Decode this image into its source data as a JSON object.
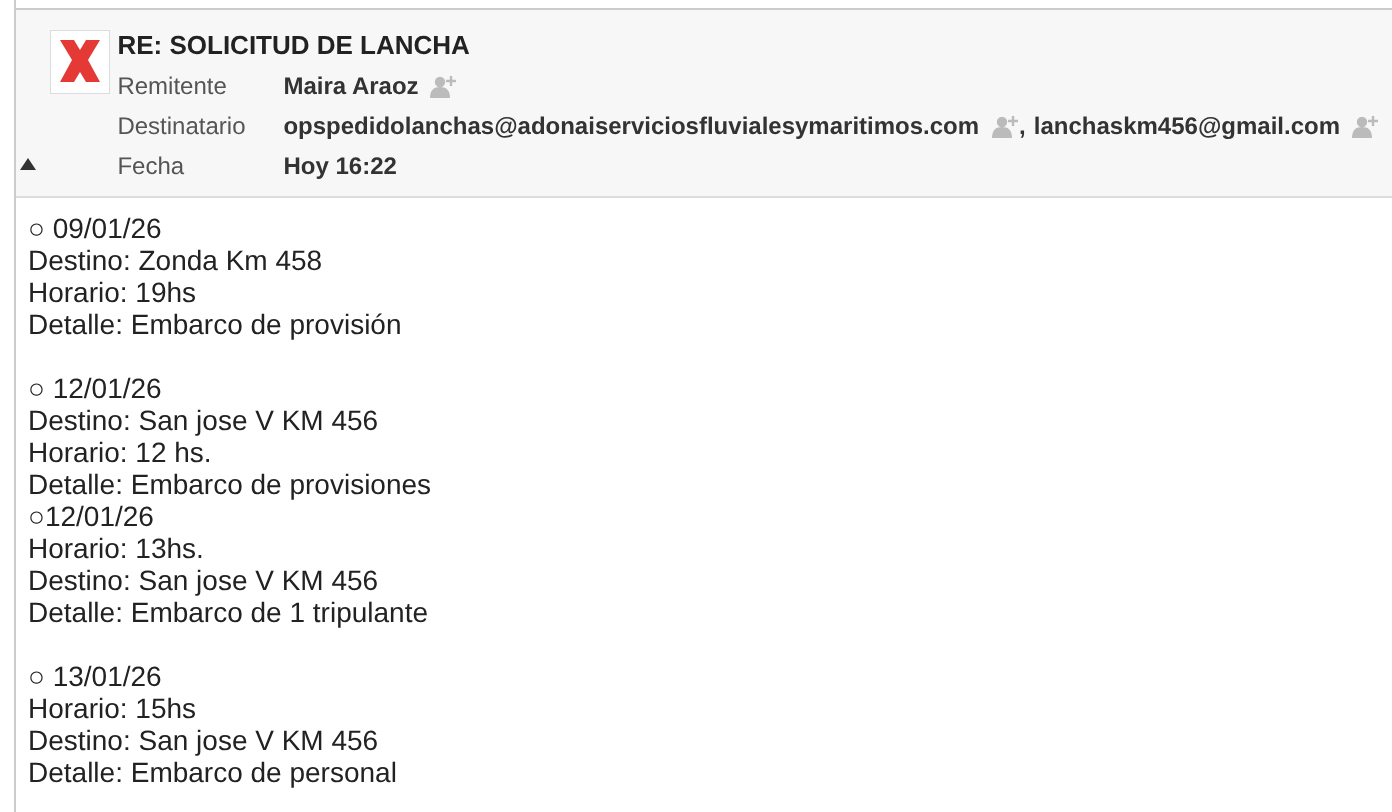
{
  "message": {
    "subject": "RE: SOLICITUD DE LANCHA",
    "headers": [
      {
        "kind": "sender",
        "label": "Remitente",
        "values": [
          {
            "text": "Maira Araoz"
          }
        ]
      },
      {
        "kind": "recipients",
        "label": "Destinatario",
        "values": [
          {
            "text": "opspedidolanchas@adonaiserviciosfluvialesymaritimos.com",
            "trailing": ","
          },
          {
            "text": "lanchaskm456@gmail.com"
          }
        ]
      },
      {
        "kind": "date",
        "label": "Fecha",
        "values": [
          {
            "text": "Hoy 16:22"
          }
        ]
      }
    ],
    "expanded": true,
    "body": [
      [
        "○ 09/01/26",
        "Destino: Zonda Km 458",
        "Horario: 19hs",
        "Detalle: Embarco de provisión"
      ],
      [
        "○ 12/01/26",
        "Destino: San jose V KM 456",
        "Horario: 12 hs.",
        "Detalle: Embarco de provisiones",
        "○12/01/26",
        "Horario: 13hs.",
        "Destino: San jose V KM 456",
        "Detalle: Embarco de 1 tripulante"
      ],
      [
        "○ 13/01/26",
        "Horario: 15hs",
        "Destino: San jose V KM 456",
        "Detalle: Embarco de personal"
      ]
    ]
  }
}
